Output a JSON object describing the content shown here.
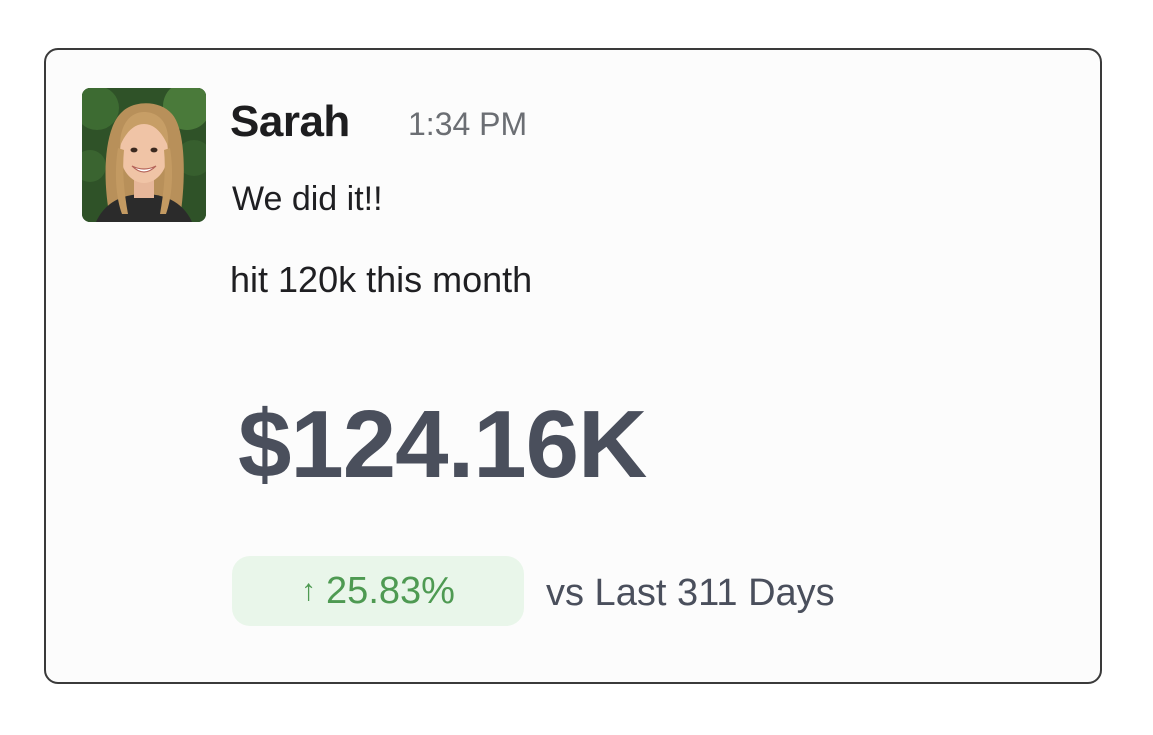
{
  "message": {
    "author": "Sarah",
    "timestamp": "1:34 PM",
    "lines": [
      "We did it!!",
      "hit 120k this month"
    ],
    "avatar_icon": "user-photo-avatar"
  },
  "metric": {
    "value": "$124.16K",
    "change": "25.83%",
    "change_direction_icon": "arrow-up-icon",
    "change_color": "#4e9a52",
    "change_bg": "#e9f6ea",
    "comparison": "vs Last 311 Days"
  }
}
